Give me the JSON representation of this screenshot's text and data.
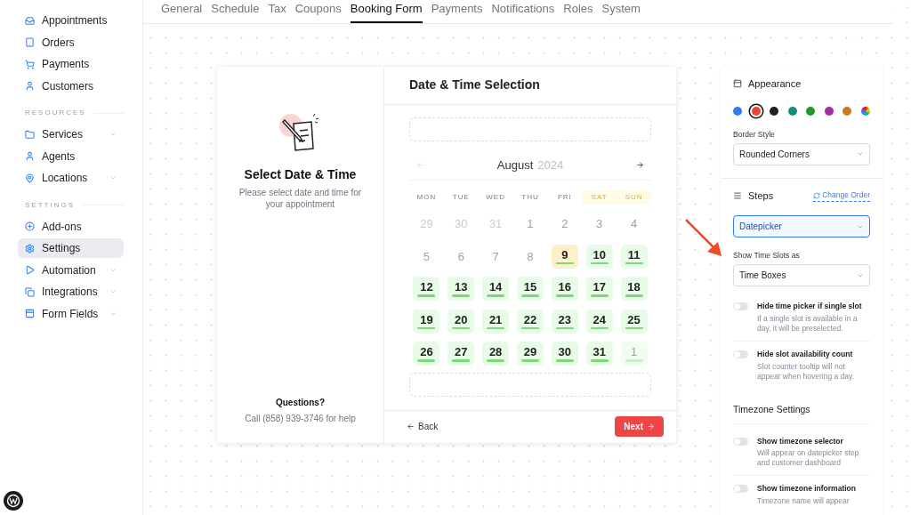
{
  "sidebar": {
    "items": [
      {
        "kind": "link",
        "label": "Appointments",
        "selected": false,
        "expandable": false
      },
      {
        "kind": "link",
        "label": "Orders",
        "selected": false,
        "expandable": false
      },
      {
        "kind": "link",
        "label": "Payments",
        "selected": false,
        "expandable": false
      },
      {
        "kind": "link",
        "label": "Customers",
        "selected": false,
        "expandable": false
      },
      {
        "kind": "heading",
        "label": "RESOURCES"
      },
      {
        "kind": "link",
        "label": "Services",
        "selected": false,
        "expandable": true
      },
      {
        "kind": "link",
        "label": "Agents",
        "selected": false,
        "expandable": false
      },
      {
        "kind": "link",
        "label": "Locations",
        "selected": false,
        "expandable": true
      },
      {
        "kind": "heading",
        "label": "SETTINGS"
      },
      {
        "kind": "link",
        "label": "Add-ons",
        "selected": false,
        "expandable": false
      },
      {
        "kind": "link",
        "label": "Settings",
        "selected": true,
        "expandable": false
      },
      {
        "kind": "link",
        "label": "Automation",
        "selected": false,
        "expandable": true
      },
      {
        "kind": "link",
        "label": "Integrations",
        "selected": false,
        "expandable": true
      },
      {
        "kind": "link",
        "label": "Form Fields",
        "selected": false,
        "expandable": true
      }
    ]
  },
  "tabs": [
    {
      "label": "General",
      "selected": false
    },
    {
      "label": "Schedule",
      "selected": false
    },
    {
      "label": "Tax",
      "selected": false
    },
    {
      "label": "Coupons",
      "selected": false
    },
    {
      "label": "Booking Form",
      "selected": true
    },
    {
      "label": "Payments",
      "selected": false
    },
    {
      "label": "Notifications",
      "selected": false
    },
    {
      "label": "Roles",
      "selected": false
    },
    {
      "label": "System",
      "selected": false
    }
  ],
  "preview": {
    "side": {
      "title": "Select Date & Time",
      "description": "Please select date and time for your appointment",
      "help_title": "Questions?",
      "help_text": "Call (858) 939-3746 for help"
    },
    "step_title": "Date & Time Selection",
    "month": "August",
    "year": "2024",
    "weekdays": [
      {
        "label": "MON",
        "weekend": false
      },
      {
        "label": "TUE",
        "weekend": false
      },
      {
        "label": "WED",
        "weekend": false
      },
      {
        "label": "THU",
        "weekend": false
      },
      {
        "label": "FRI",
        "weekend": false
      },
      {
        "label": "SAT",
        "weekend": true
      },
      {
        "label": "SUN",
        "weekend": true
      }
    ],
    "days": [
      {
        "label": "29",
        "kind": "outside"
      },
      {
        "label": "30",
        "kind": "outside"
      },
      {
        "label": "31",
        "kind": "outside"
      },
      {
        "label": "1",
        "kind": "past"
      },
      {
        "label": "2",
        "kind": "past"
      },
      {
        "label": "3",
        "kind": "past"
      },
      {
        "label": "4",
        "kind": "past"
      },
      {
        "label": "5",
        "kind": "past"
      },
      {
        "label": "6",
        "kind": "past"
      },
      {
        "label": "7",
        "kind": "past"
      },
      {
        "label": "8",
        "kind": "past"
      },
      {
        "label": "9",
        "kind": "today"
      },
      {
        "label": "10",
        "kind": "available"
      },
      {
        "label": "11",
        "kind": "available"
      },
      {
        "label": "12",
        "kind": "available"
      },
      {
        "label": "13",
        "kind": "available"
      },
      {
        "label": "14",
        "kind": "available"
      },
      {
        "label": "15",
        "kind": "available"
      },
      {
        "label": "16",
        "kind": "available"
      },
      {
        "label": "17",
        "kind": "available"
      },
      {
        "label": "18",
        "kind": "available"
      },
      {
        "label": "19",
        "kind": "available"
      },
      {
        "label": "20",
        "kind": "available"
      },
      {
        "label": "21",
        "kind": "available"
      },
      {
        "label": "22",
        "kind": "available"
      },
      {
        "label": "23",
        "kind": "available"
      },
      {
        "label": "24",
        "kind": "available"
      },
      {
        "label": "25",
        "kind": "available"
      },
      {
        "label": "26",
        "kind": "available"
      },
      {
        "label": "27",
        "kind": "available"
      },
      {
        "label": "28",
        "kind": "available"
      },
      {
        "label": "29",
        "kind": "available"
      },
      {
        "label": "30",
        "kind": "available"
      },
      {
        "label": "31",
        "kind": "available"
      },
      {
        "label": "1",
        "kind": "next"
      }
    ],
    "back": "Back",
    "next": "Next"
  },
  "panel": {
    "appearance_title": "Appearance",
    "colors": [
      {
        "color": "#2f7cf6",
        "selected": false,
        "kind": "solid"
      },
      {
        "color": "#e8453c",
        "selected": true,
        "kind": "solid"
      },
      {
        "color": "#1f1f1f",
        "selected": false,
        "kind": "solid"
      },
      {
        "color": "#1a8a7a",
        "selected": false,
        "kind": "solid"
      },
      {
        "color": "#1f9a2b",
        "selected": false,
        "kind": "solid"
      },
      {
        "color": "#a52ba3",
        "selected": false,
        "kind": "solid"
      },
      {
        "color": "#cc7a22",
        "selected": false,
        "kind": "solid"
      },
      {
        "selected": false,
        "kind": "multicolor"
      }
    ],
    "border_style_label": "Border Style",
    "border_style": "Rounded Corners",
    "steps_title": "Steps",
    "change_order": "Change Order",
    "step": "Datepicker",
    "time_slots_label": "Show Time Slots as",
    "time_slots": "Time Boxes",
    "toggles": [
      {
        "title": "Hide time picker if single slot",
        "description": "If a single slot is available in a day, it will be preselected.",
        "on": false
      },
      {
        "title": "Hide slot availability count",
        "description": "Slot counter tooltip will not appear when hovering a day.",
        "on": false
      }
    ],
    "timezone_title": "Timezone Settings",
    "timezone_toggles": [
      {
        "title": "Show timezone selector",
        "description": "Will appear on datepicker step and customer dashboard",
        "on": false
      },
      {
        "title": "Show timezone information",
        "description": "Timezone name will appear",
        "on": false
      }
    ]
  }
}
